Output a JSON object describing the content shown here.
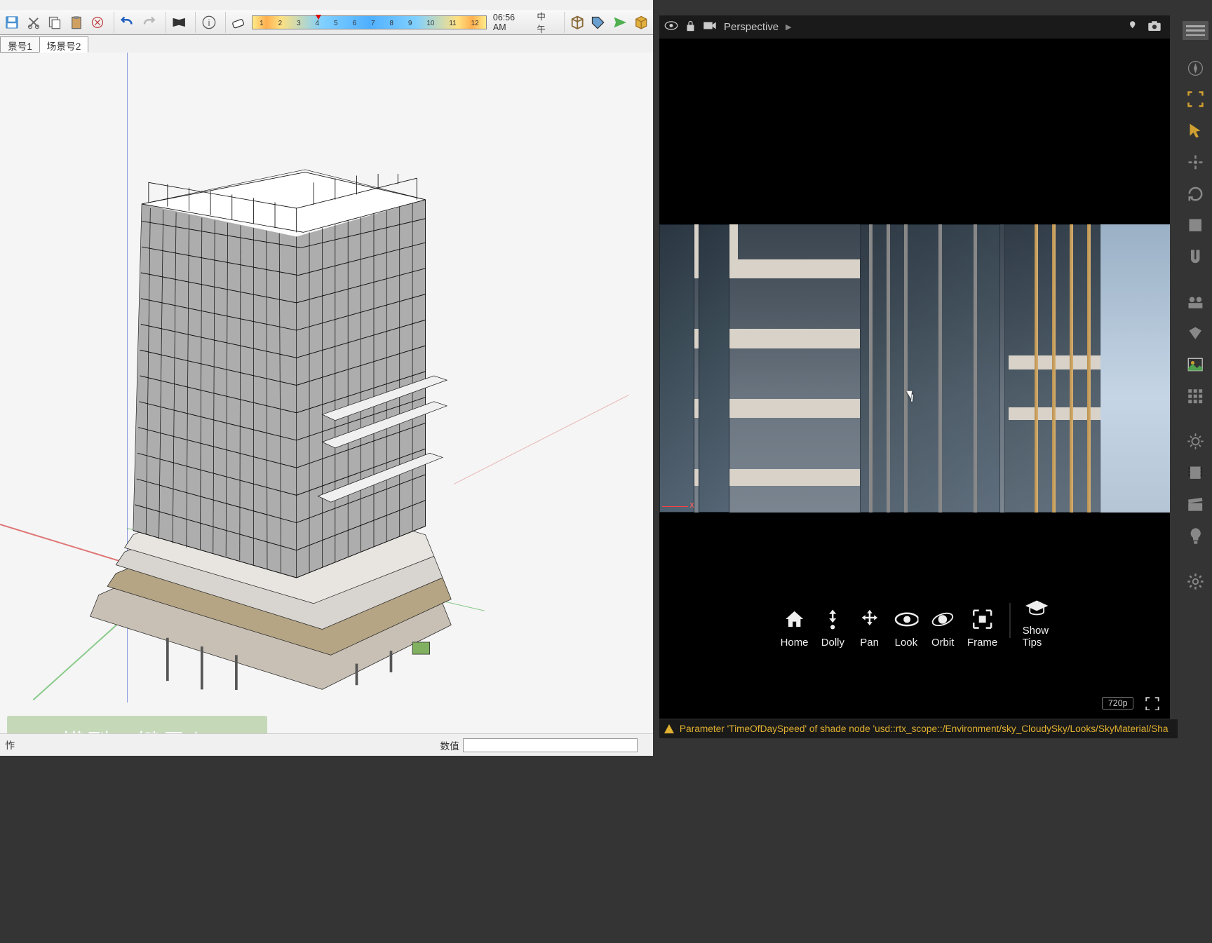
{
  "su_toolbar": {
    "tabs": [
      "景号1",
      "场景号2"
    ],
    "time_numbers": [
      "1",
      "2",
      "3",
      "4",
      "5",
      "6",
      "7",
      "8",
      "9",
      "10",
      "11",
      "12"
    ],
    "time_display": "06:56 AM",
    "period": "中午"
  },
  "green_banner": "模型一键导入",
  "su_status": {
    "left_label": "怍",
    "right_label": "数值",
    "right_value": ""
  },
  "rp_header": {
    "camera_mode": "Perspective"
  },
  "nav_tools": [
    {
      "label": "Home",
      "icon": "home"
    },
    {
      "label": "Dolly",
      "icon": "dolly"
    },
    {
      "label": "Pan",
      "icon": "pan"
    },
    {
      "label": "Look",
      "icon": "look"
    },
    {
      "label": "Orbit",
      "icon": "orbit"
    },
    {
      "label": "Frame",
      "icon": "frame"
    },
    {
      "label": "Show Tips",
      "icon": "grad"
    }
  ],
  "axis_label": "x",
  "resolution": "720p",
  "warning_text": "Parameter 'TimeOfDaySpeed' of shade node 'usd::rtx_scope::/Environment/sky_CloudySky/Looks/SkyMaterial/Sha"
}
